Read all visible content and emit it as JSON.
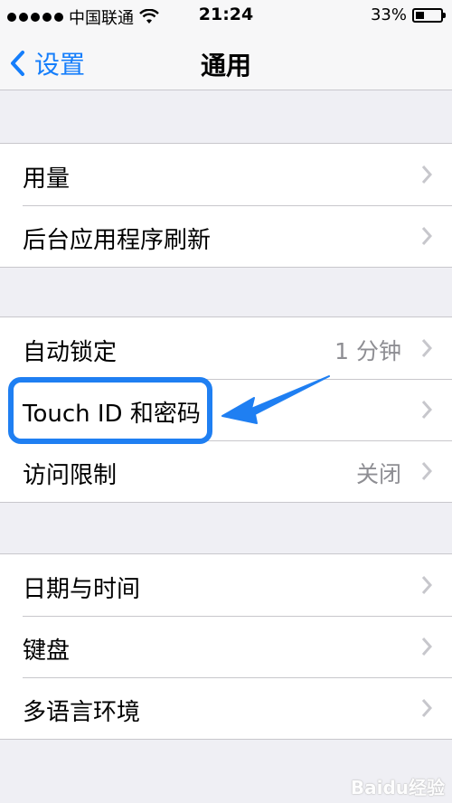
{
  "status_bar": {
    "carrier": "中国联通",
    "time": "21:24",
    "battery": "33%",
    "battery_level": 0.33
  },
  "nav": {
    "back_label": "设置",
    "title": "通用"
  },
  "groups": [
    {
      "rows": [
        {
          "label": "用量",
          "value": ""
        },
        {
          "label": "后台应用程序刷新",
          "value": ""
        }
      ]
    },
    {
      "rows": [
        {
          "label": "自动锁定",
          "value": "1 分钟"
        },
        {
          "label": "Touch ID 和密码",
          "value": ""
        },
        {
          "label": "访问限制",
          "value": "关闭"
        }
      ]
    },
    {
      "rows": [
        {
          "label": "日期与时间",
          "value": ""
        },
        {
          "label": "键盘",
          "value": ""
        },
        {
          "label": "多语言环境",
          "value": ""
        }
      ]
    }
  ],
  "annotation": {
    "color": "#1f7ff2"
  },
  "watermark": "Baidu经验",
  "colors": {
    "accent": "#157efb",
    "background": "#efeff4",
    "separator": "#c8c7cc"
  }
}
